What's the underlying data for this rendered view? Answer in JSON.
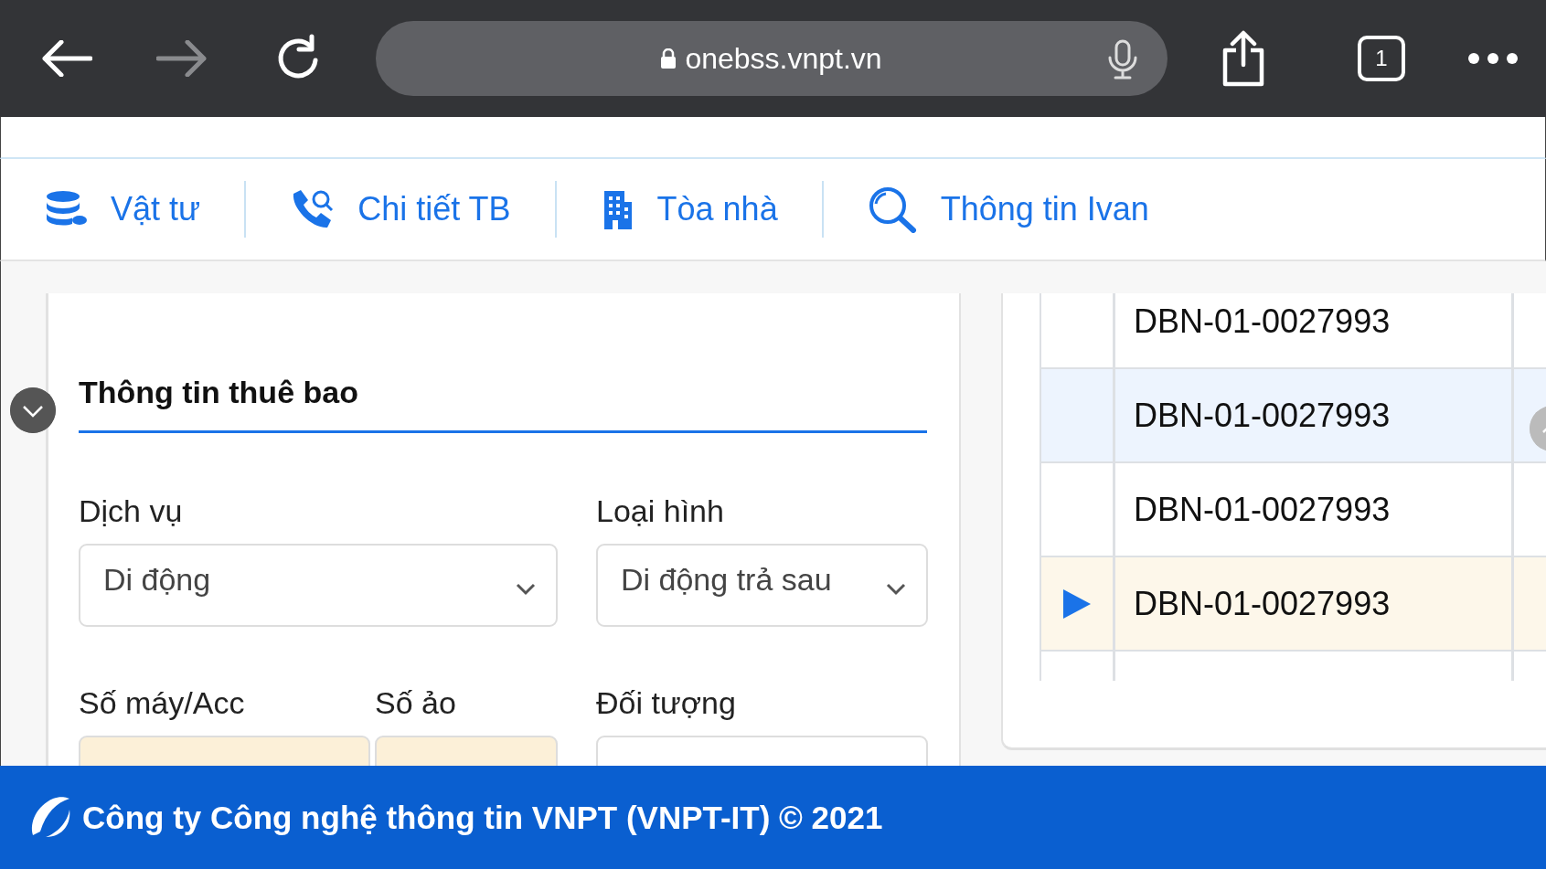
{
  "browser": {
    "url": "onebss.vnpt.vn",
    "tab_count": "1",
    "forward_disabled": true
  },
  "nav": [
    {
      "label": "Vật tư"
    },
    {
      "label": "Chi tiết TB"
    },
    {
      "label": "Tòa nhà"
    },
    {
      "label": "Thông tin Ivan"
    }
  ],
  "form": {
    "title": "Thông tin thuê bao",
    "fields": [
      {
        "label": "Dịch vụ",
        "kind": "select",
        "value": "Di động"
      },
      {
        "label": "Loại hình",
        "kind": "select",
        "value": "Di động trả sau"
      },
      {
        "label": "Số máy/Acc",
        "kind": "input",
        "highlighted": true
      },
      {
        "label": "Số ảo",
        "kind": "input",
        "highlighted": true
      },
      {
        "label": "Đối tượng",
        "kind": "input",
        "highlighted": false
      }
    ]
  },
  "table": {
    "rows": [
      {
        "cells": [
          "DBN-01-0027993"
        ],
        "selected": false,
        "current": false
      },
      {
        "cells": [
          "DBN-01-0027993"
        ],
        "selected": true,
        "current": false
      },
      {
        "cells": [
          "DBN-01-0027993"
        ],
        "selected": false,
        "current": false
      },
      {
        "cells": [
          "DBN-01-0027993"
        ],
        "selected": false,
        "current": true
      }
    ]
  },
  "footer": {
    "text": "Công ty Công nghệ thông tin VNPT (VNPT-IT) © 2021"
  }
}
